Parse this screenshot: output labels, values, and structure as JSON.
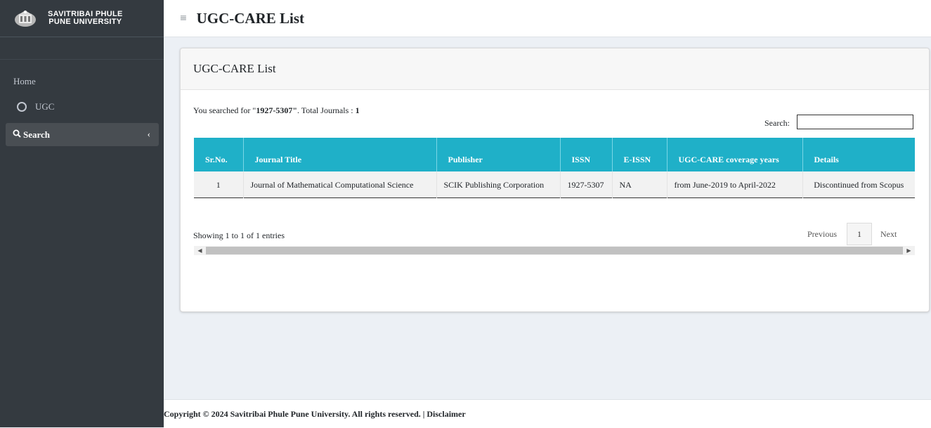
{
  "sidebar": {
    "brand_line1": "SAVITRIBAI PHULE",
    "brand_line2": "PUNE UNIVERSITY",
    "home_label": "Home",
    "ugc_label": "UGC",
    "search_label": "Search"
  },
  "header": {
    "menu_icon": "≡",
    "title": "UGC-CARE List"
  },
  "card": {
    "title": "UGC-CARE List",
    "searched_prefix": "You searched for \"",
    "searched_term": "1927-5307\"",
    "searched_mid": ". Total Journals : ",
    "total_journals": "1",
    "search_label": "Search:",
    "search_value": ""
  },
  "table": {
    "headers": [
      "Sr.No.",
      "Journal Title",
      "Publisher",
      "ISSN",
      "E-ISSN",
      "UGC-CARE coverage years",
      "Details"
    ],
    "rows": [
      [
        "1",
        "Journal of Mathematical Computational Science",
        "SCIK Publishing Corporation",
        "1927-5307",
        "NA",
        "from June-2019 to April-2022",
        "Discontinued from Scopus"
      ]
    ]
  },
  "pagination": {
    "info": "Showing 1 to 1 of 1 entries",
    "previous": "Previous",
    "current_page": "1",
    "next": "Next"
  },
  "footer": {
    "text": "Copyright © 2024 Savitribai Phule Pune University. All rights reserved. | Disclaimer"
  },
  "colors": {
    "sidebar_bg": "#343a40",
    "table_header_bg": "#1fb0c8",
    "page_bg": "#ecf0f5"
  }
}
